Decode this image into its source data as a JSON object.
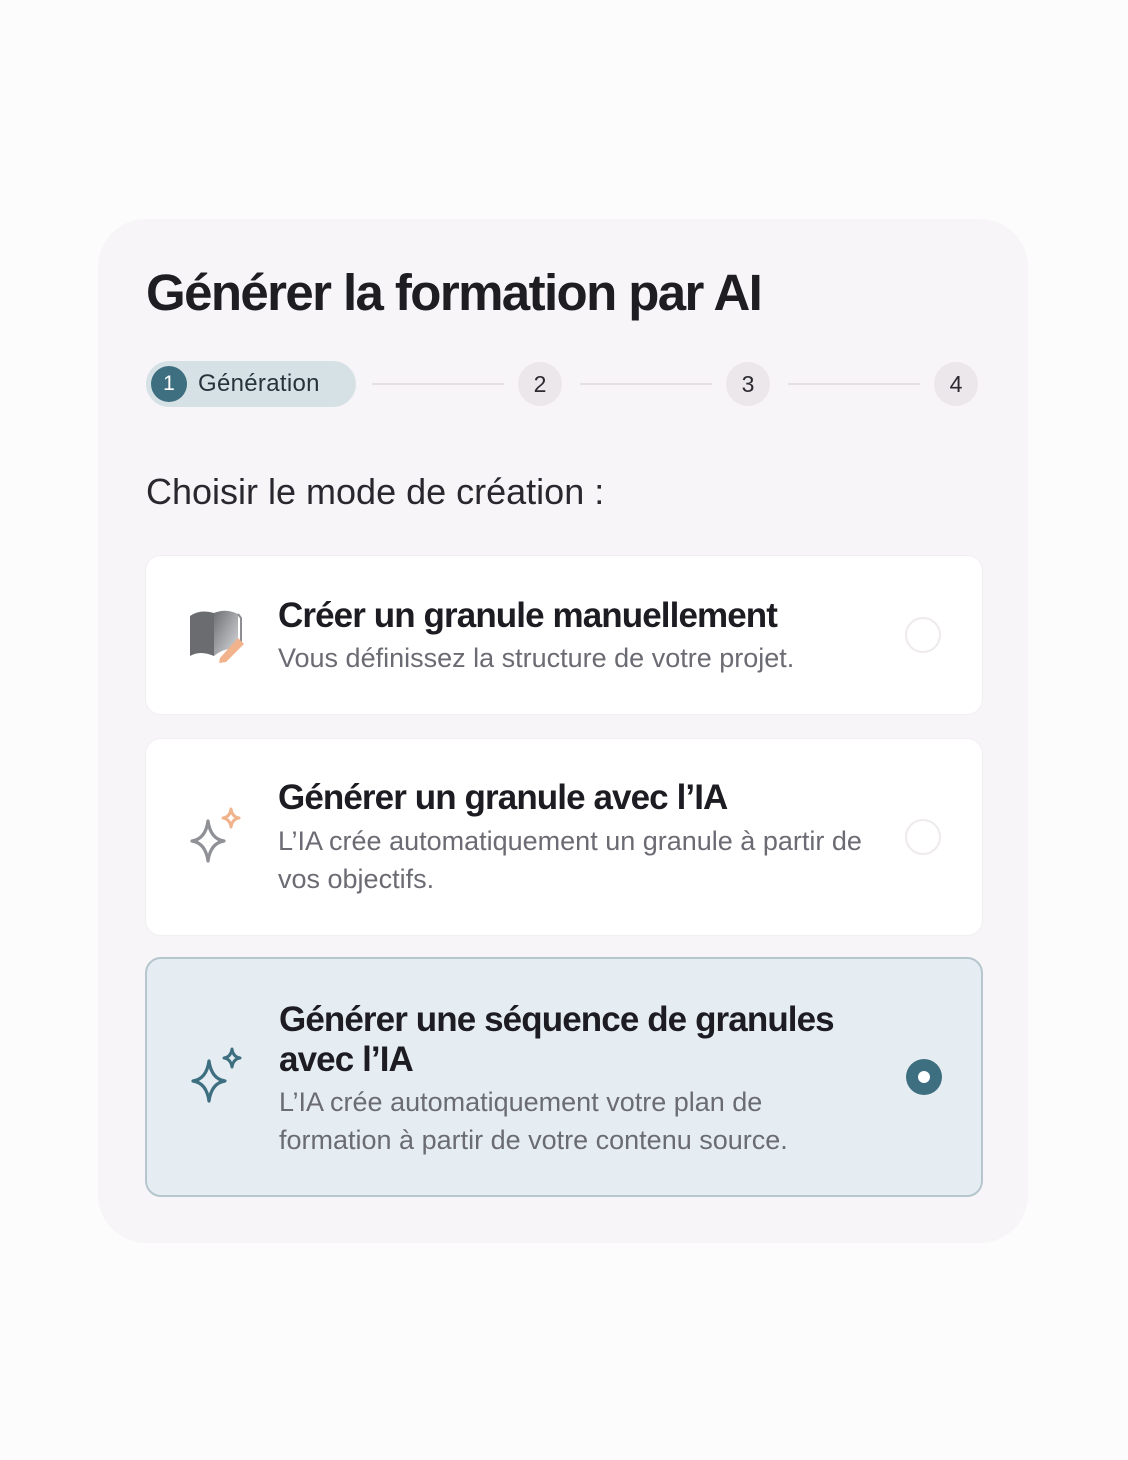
{
  "dialog": {
    "title": "Générer la formation par AI",
    "subtitle": "Choisir le mode de création :"
  },
  "stepper": {
    "steps": [
      {
        "number": "1",
        "label": "Génération",
        "active": true
      },
      {
        "number": "2",
        "label": "",
        "active": false
      },
      {
        "number": "3",
        "label": "",
        "active": false
      },
      {
        "number": "4",
        "label": "",
        "active": false
      }
    ]
  },
  "options": [
    {
      "title": "Créer un granule manuellement",
      "description": "Vous définissez la structure de votre projet.",
      "icon": "book-pencil-icon",
      "selected": false
    },
    {
      "title": "Générer un granule avec l’IA",
      "description": "L’IA crée automatiquement un granule à partir de vos objectifs.",
      "icon": "sparkle-icon",
      "selected": false
    },
    {
      "title": "Générer une séquence de granules avec l’IA",
      "description": "L’IA crée automatiquement votre plan de formation à partir de votre contenu source.",
      "icon": "sparkle-icon",
      "selected": true
    }
  ],
  "colors": {
    "accent": "#3d6f80",
    "active_step_bg": "#d6e1e6",
    "selected_option_bg": "#e6edf2",
    "card_bg": "#f7f5f7",
    "sparkle_orange": "#f0b48c"
  }
}
